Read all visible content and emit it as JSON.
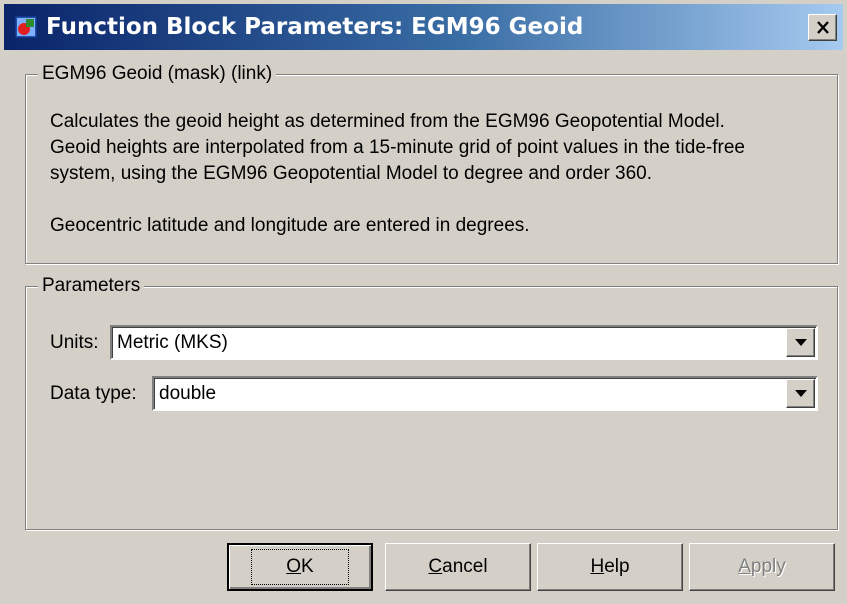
{
  "window": {
    "title": "Function Block Parameters: EGM96 Geoid",
    "close_icon": "close-x-icon",
    "app_icon": "simulink-block-icon"
  },
  "description": {
    "legend": "EGM96 Geoid (mask) (link)",
    "lines": [
      "Calculates the geoid height as determined from the EGM96 Geopotential Model.",
      "Geoid heights are interpolated from a 15-minute grid of point values in the tide-free",
      "system, using the EGM96 Geopotential Model to degree and order 360.",
      "Geocentric latitude and longitude are entered in degrees."
    ]
  },
  "parameters": {
    "legend": "Parameters",
    "units": {
      "label": "Units:",
      "value": "Metric (MKS)"
    },
    "data_type": {
      "label": "Data type:",
      "value": "double"
    }
  },
  "buttons": {
    "ok": {
      "mnemonic": "O",
      "rest": "K"
    },
    "cancel": {
      "mnemonic": "C",
      "rest": "ancel"
    },
    "help": {
      "mnemonic": "H",
      "rest": "elp"
    },
    "apply": {
      "mnemonic": "A",
      "rest": "pply",
      "enabled": false
    }
  }
}
